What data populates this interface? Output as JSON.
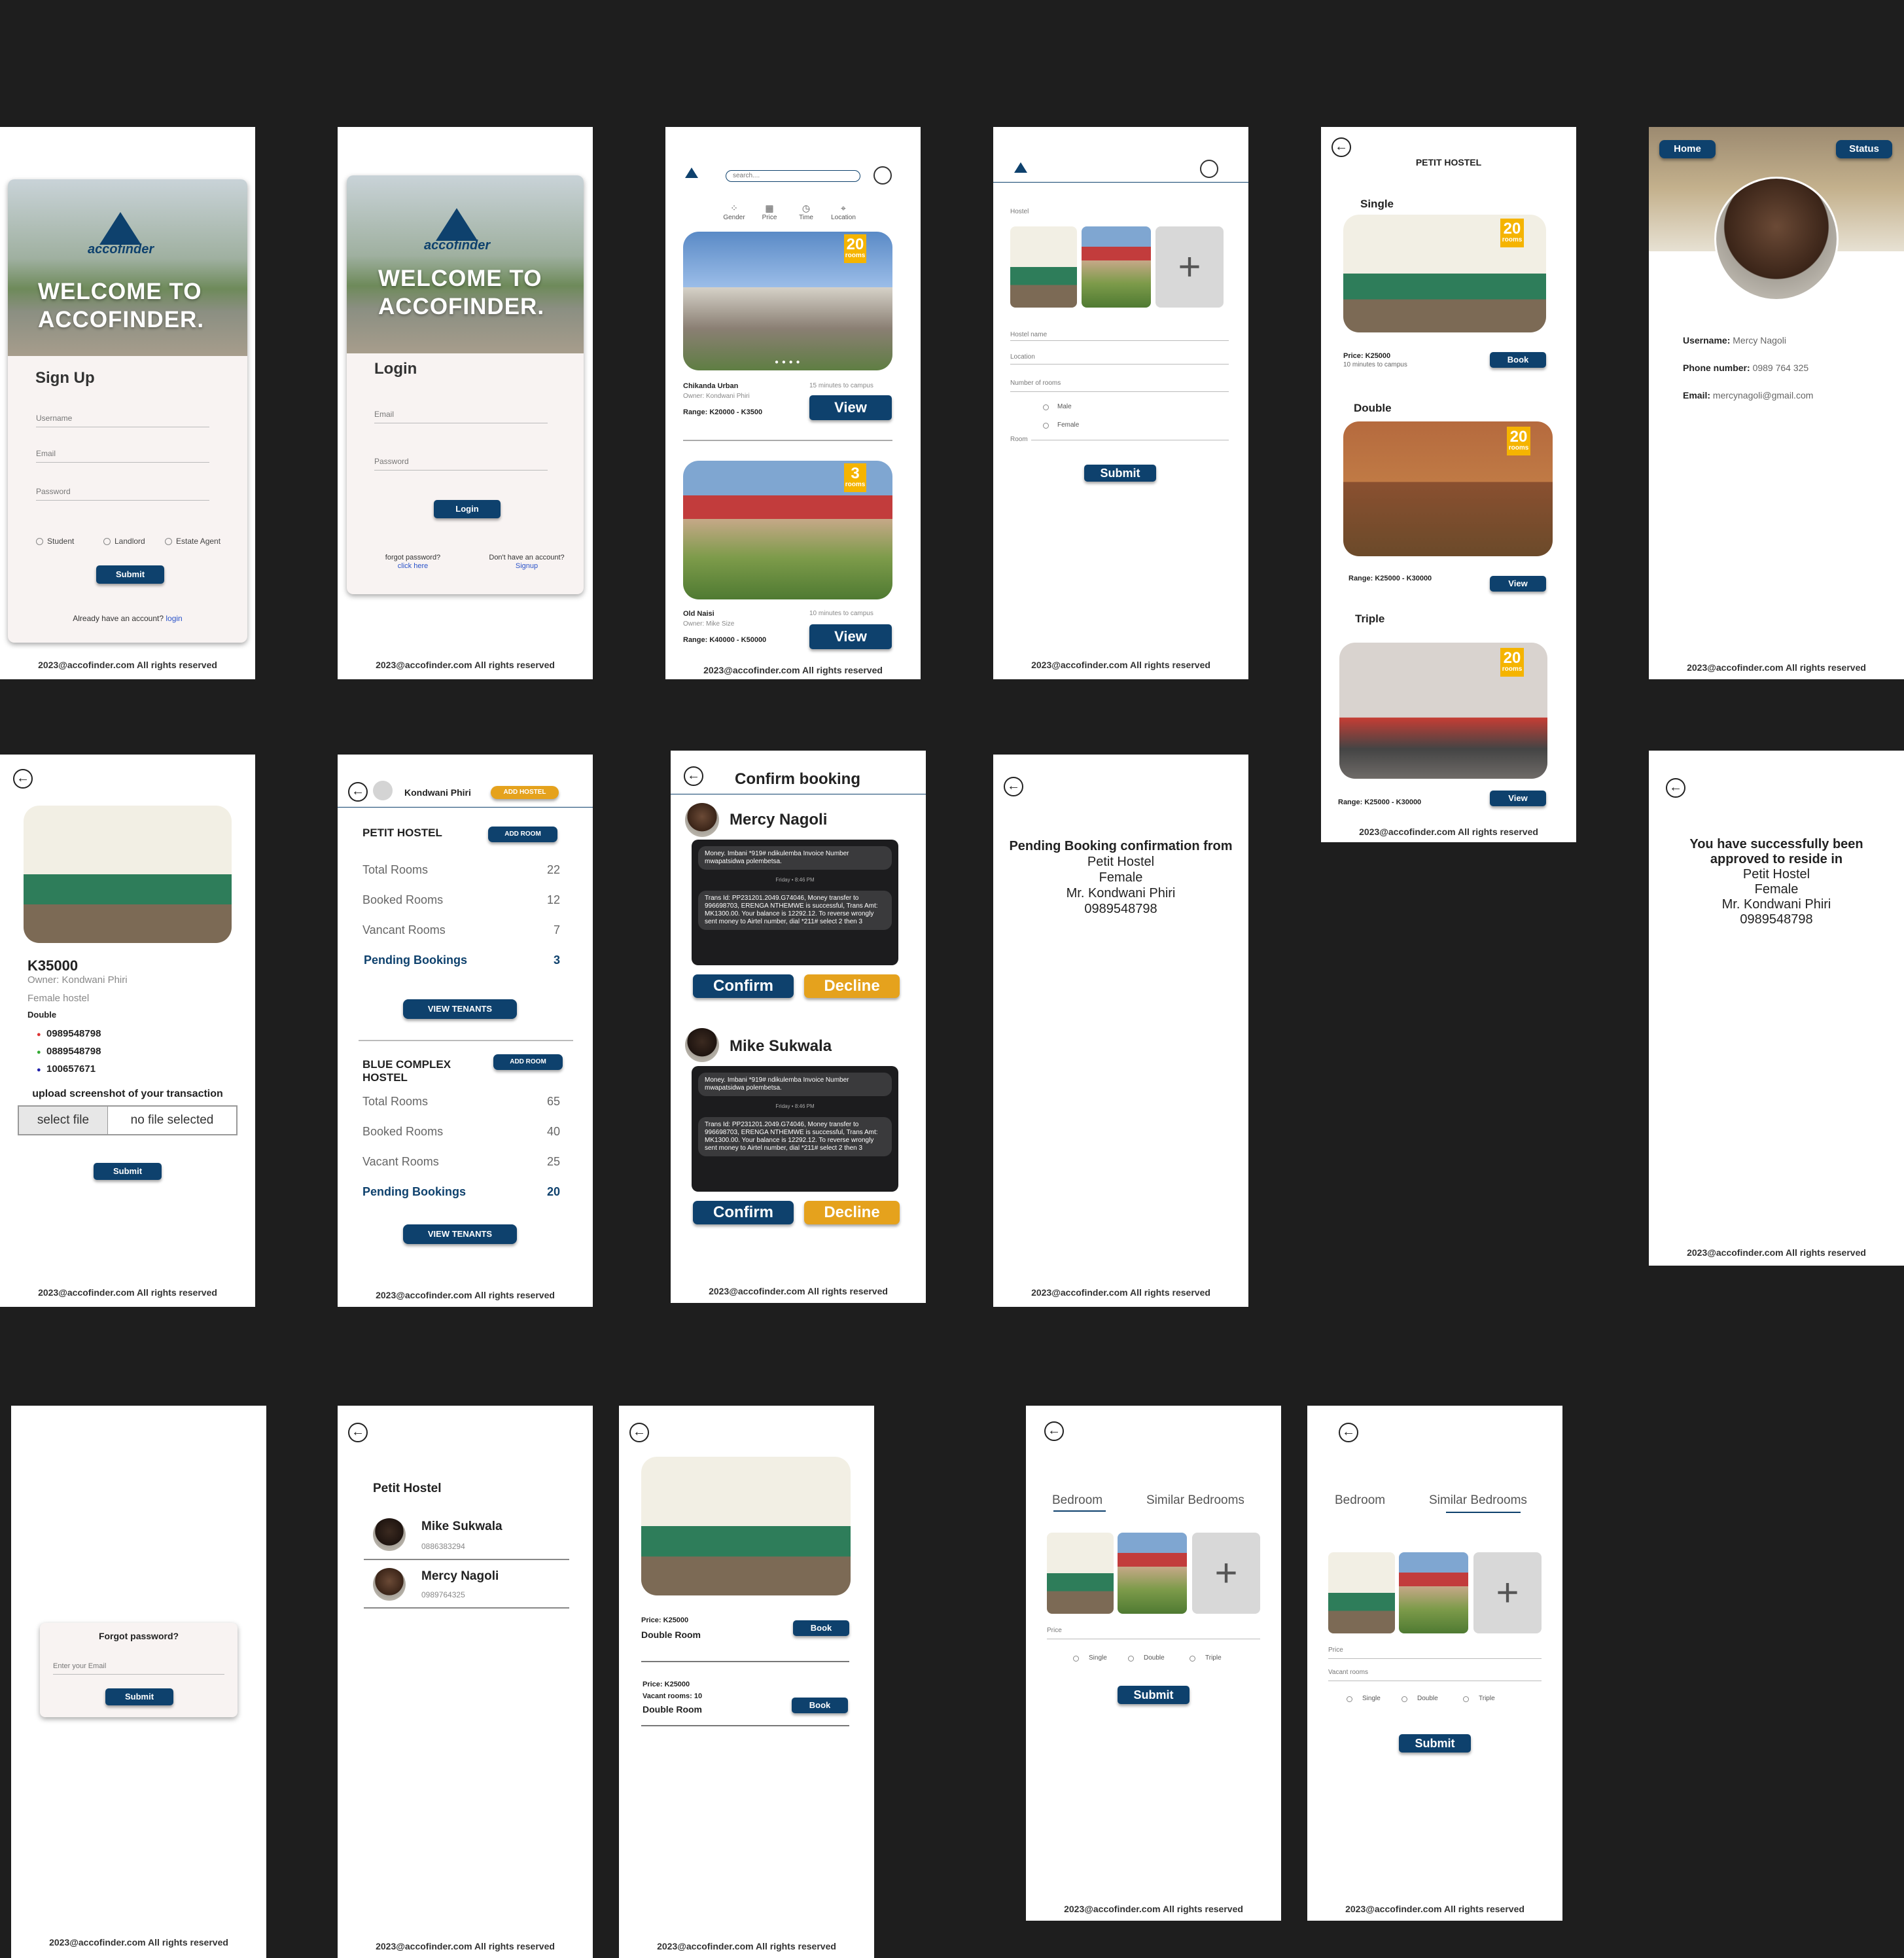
{
  "footer": "2023@accofinder.com All rights reserved",
  "brand": {
    "logo_text": "accofinder",
    "welcome": "WELCOME TO ACCOFINDER."
  },
  "signup": {
    "title": "Sign Up",
    "username": "Username",
    "email": "Email",
    "password": "Password",
    "roles": [
      "Student",
      "Landlord",
      "Estate Agent"
    ],
    "submit": "Submit",
    "have_account": "Already have an account?",
    "login_link": "login"
  },
  "login": {
    "title": "Login",
    "email": "Email",
    "password": "Password",
    "submit": "Login",
    "forgot": "forgot password?",
    "click_here": "click here",
    "no_account": "Don't have an account?",
    "signup_link": "Signup"
  },
  "search": {
    "placeholder": "search....",
    "filters": [
      "Gender",
      "Price",
      "Time",
      "Location"
    ],
    "listings": [
      {
        "name": "Chikanda Urban",
        "distance": "15 minutes to campus",
        "owner": "Owner:  Kondwani Phiri",
        "range": "Range: K20000 - K3500",
        "badge": "20",
        "badge_unit": "rooms",
        "view": "View"
      },
      {
        "name": "Old Naisi",
        "distance": "10 minutes to campus",
        "owner": "Owner:  Mike Size",
        "range": "Range: K40000 - K50000",
        "badge": "3",
        "badge_unit": "rooms",
        "view": "View"
      }
    ]
  },
  "add_hostel": {
    "hostel_label": "Hostel",
    "hostel_name": "Hostel name",
    "location": "Location",
    "rooms": "Number of rooms",
    "male": "Male",
    "female": "Female",
    "room": "Room",
    "submit": "Submit",
    "plus": "+"
  },
  "petit": {
    "title": "PETIT HOSTEL",
    "sections": [
      {
        "name": "Single",
        "badge": "20",
        "badge_unit": "rooms",
        "price": "Price: K25000",
        "sub": "10 minutes to campus",
        "btn": "Book"
      },
      {
        "name": "Double",
        "badge": "20",
        "badge_unit": "rooms",
        "price": "Range: K25000 - K30000",
        "sub": "",
        "btn": "View"
      },
      {
        "name": "Triple",
        "badge": "20",
        "badge_unit": "rooms",
        "price": "Range: K25000 - K30000",
        "sub": "",
        "btn": "View"
      }
    ]
  },
  "profile": {
    "home": "Home",
    "status": "Status",
    "username_label": "Username:",
    "username": "Mercy Nagoli",
    "phone_label": "Phone number:",
    "phone": "0989 764 325",
    "email_label": "Email:",
    "email": "mercynagoli@gmail.com"
  },
  "detail": {
    "price": "K35000",
    "owner": "Owner:  Kondwani Phiri",
    "type": "Female hostel",
    "room": "Double",
    "phones": [
      "0989548798",
      "0889548798",
      "100657671"
    ],
    "upload": "upload screenshot of your transaction",
    "select_file": "select file",
    "no_file": "no file selected",
    "submit": "Submit"
  },
  "landlord": {
    "name": "Kondwani Phiri",
    "add_hostel": "ADD HOSTEL",
    "hostels": [
      {
        "name": "PETIT HOSTEL",
        "add_room": "ADD ROOM",
        "rows": [
          [
            "Total  Rooms",
            "22"
          ],
          [
            "Booked Rooms",
            "12"
          ],
          [
            "Vancant Rooms",
            "7"
          ]
        ],
        "pending_label": "Pending Bookings",
        "pending": "3",
        "view": "VIEW TENANTS"
      },
      {
        "name": "BLUE COMPLEX HOSTEL",
        "add_room": "ADD ROOM",
        "rows": [
          [
            "Total  Rooms",
            "65"
          ],
          [
            "Booked Rooms",
            "40"
          ],
          [
            "Vacant Rooms",
            "25"
          ]
        ],
        "pending_label": "Pending Bookings",
        "pending": "20",
        "view": "VIEW TENANTS"
      }
    ]
  },
  "confirm": {
    "title": "Confirm booking",
    "sms_top": "Money. Imbani *919# ndikulemba Invoice Number mwapatsidwa polembetsa.",
    "sms_day": "Friday • 8:46 PM",
    "sms_body": "Trans Id: PP231201.2049.G74046, Money transfer to 996698703, ERENGA NTHEMWE is successful, Trans Amt: MK1300.00. Your balance is 12292.12. To reverse wrongly sent money to Airtel number, dial *211# select 2 then 3",
    "people": [
      "Mercy Nagoli",
      "Mike Sukwala"
    ],
    "confirm": "Confirm",
    "decline": "Decline"
  },
  "pending": {
    "title": "Pending Booking confirmation from",
    "lines": [
      "Petit Hostel",
      "Female",
      "Mr. Kondwani Phiri",
      "0989548798"
    ]
  },
  "approved": {
    "title": "You have successfully been approved to reside in",
    "lines": [
      "Petit Hostel",
      "Female",
      "Mr. Kondwani Phiri",
      "0989548798"
    ]
  },
  "forgot": {
    "title": "Forgot password?",
    "placeholder": "Enter your Email",
    "submit": "Submit"
  },
  "tenants": {
    "hostel": "Petit Hostel",
    "people": [
      {
        "name": "Mike Sukwala",
        "phone": "0886383294"
      },
      {
        "name": "Mercy Nagoli",
        "phone": "0989764325"
      }
    ]
  },
  "rooms_list": {
    "items": [
      {
        "price": "Price: K25000",
        "vacant": "",
        "type": "Double Room",
        "btn": "Book"
      },
      {
        "price": "Price: K25000",
        "vacant": "Vacant rooms: 10",
        "type": "Double Room",
        "btn": "Book"
      }
    ]
  },
  "bedroom_form": {
    "tab1": "Bedroom",
    "tab2": "Similar Bedrooms",
    "price": "Price",
    "vacant": "Vacant rooms",
    "options": [
      "Single",
      "Double",
      "Triple"
    ],
    "submit": "Submit",
    "plus": "+"
  },
  "colors": {
    "navy": "#0e416d",
    "gold": "#e5a21d",
    "badge": "#f5b400",
    "background": "#1e1e1e"
  }
}
